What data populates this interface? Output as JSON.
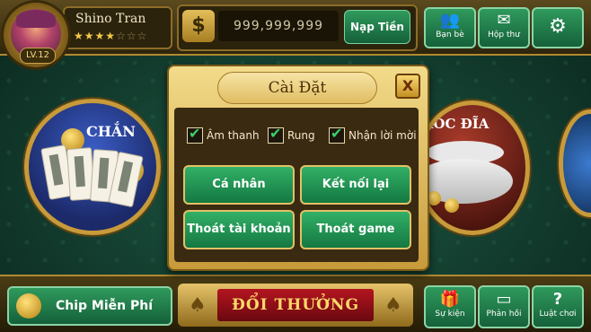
{
  "profile": {
    "name": "Shino Tran",
    "level": "LV.12",
    "rating": {
      "filled": 3,
      "half": 1,
      "total": 7
    }
  },
  "wallet": {
    "currency_icon": "$",
    "balance": "999,999,999",
    "deposit_label": "Nạp Tiền"
  },
  "top_buttons": [
    {
      "label": "Bạn bè",
      "icon": "friends-icon"
    },
    {
      "label": "Hộp thư",
      "icon": "mail-icon"
    },
    {
      "label": "",
      "icon": "gear-icon"
    }
  ],
  "games": {
    "chan_title": "CHẮN",
    "xoc_title": "XÓC ĐĨA"
  },
  "settings": {
    "title": "Cài Đặt",
    "close": "X",
    "options": [
      {
        "label": "Âm thanh",
        "checked": true
      },
      {
        "label": "Rung",
        "checked": true
      },
      {
        "label": "Nhận lời mời",
        "checked": true
      }
    ],
    "buttons": {
      "personal": "Cá nhân",
      "reconnect": "Kết nối lại",
      "logout": "Thoát tài khoản",
      "quit": "Thoát game"
    }
  },
  "bottom": {
    "free_chip": "Chip Miễn Phí",
    "reward": "ĐỔI THƯỞNG",
    "buttons": [
      {
        "label": "Sự kiện",
        "icon": "gift-icon"
      },
      {
        "label": "Phản hồi",
        "icon": "feedback-icon"
      },
      {
        "label": "Luật chơi",
        "icon": "question-icon"
      }
    ]
  },
  "colors": {
    "accent_green": "#1f8a4e",
    "gold": "#c89a3a",
    "reward_red": "#a8101b"
  }
}
